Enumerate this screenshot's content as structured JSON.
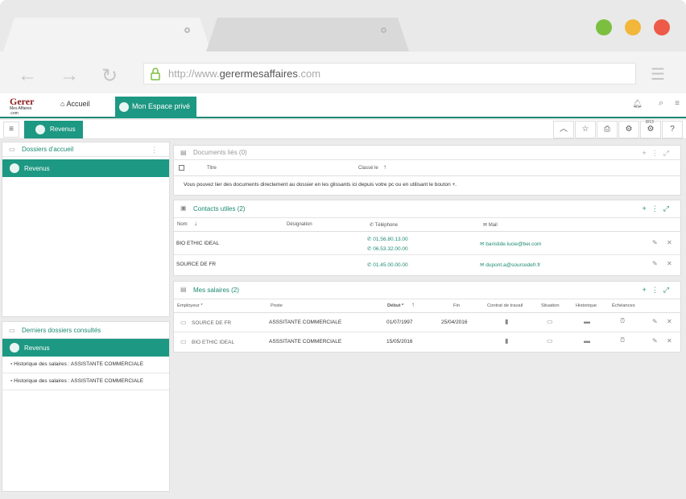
{
  "browser": {
    "url_prefix": "http://www.",
    "url_domain": "gerermesaffaires",
    "url_suffix": ".com"
  },
  "app": {
    "logo_text": "Gerer",
    "logo_sub": "Mes Affaires .com",
    "nav_home": "Accueil",
    "nav_space": "Mon Espace privé",
    "subbar_button": "Revenus",
    "badge_count": "8/13"
  },
  "left": {
    "dossiers_title": "Dossiers d'accueil",
    "dossiers_selected": "Revenus",
    "recent_title": "Derniers dossiers consultés",
    "recent_selected": "Revenus",
    "recent_items": [
      "Historique des salaires : ASSISTANTE COMMERCIALE",
      "Historique des salaires : ASSISTANTE COMMERCIALE"
    ]
  },
  "documents": {
    "title": "Documents liés (0)",
    "col_title": "Titre",
    "col_class": "Classé le",
    "empty_text": "Vous pouvez lier des documents directement au dossier en les glissants ici depuis votre pc ou en utilisant le bouton +."
  },
  "contacts": {
    "title": "Contacts utiles (2)",
    "col_name": "Nom",
    "col_designation": "Désignation",
    "col_phone": "Téléphone",
    "col_mail": "Mail",
    "rows": [
      {
        "name": "BIO ETHIC IDEAL",
        "phone1": "01.56.80.13.00",
        "phone2": "06.53.32.00.00",
        "mail": "baristide.lucie@bei.com"
      },
      {
        "name": "SOURCE DE FR",
        "phone1": "01.45.00.00.00",
        "phone2": "",
        "mail": "dupont.a@sourcedefr.fr"
      }
    ]
  },
  "salaires": {
    "title": "Mes salaires (2)",
    "col_employer": "Employeur *",
    "col_poste": "Poste",
    "col_debut": "Début *",
    "col_fin": "Fin",
    "col_contrat": "Contrat de travail",
    "col_situation": "Situation",
    "col_historique": "Historique",
    "col_echeances": "Échéances",
    "rows": [
      {
        "employer": "SOURCE DE FR",
        "poste": "ASSSITANTE COMMERCIALE",
        "debut": "01/07/1997",
        "fin": "25/04/2016"
      },
      {
        "employer": "BIO ETHIC IDEAL",
        "poste": "ASSSITANTE COMMERCIALE",
        "debut": "15/05/2016",
        "fin": ""
      }
    ]
  },
  "colors": {
    "accent": "#1d9882",
    "close": "#ed5a47",
    "minimize": "#f2b63b",
    "maximize": "#7cbf3f"
  }
}
